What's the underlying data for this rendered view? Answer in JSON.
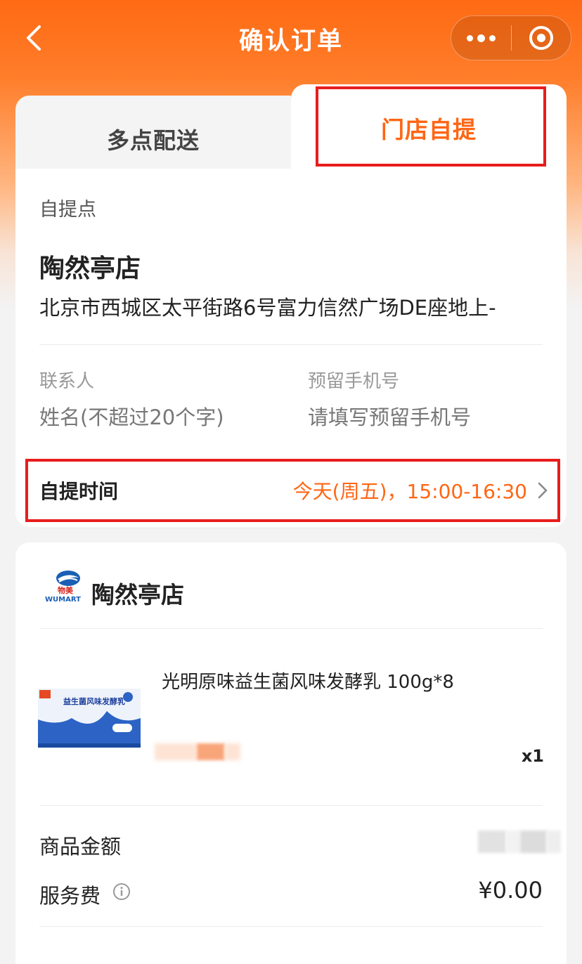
{
  "header": {
    "title": "确认订单",
    "back_icon": "chevron-left-icon",
    "more_icon": "more-dots-icon",
    "close_icon": "mini-program-close-icon"
  },
  "tabs": [
    {
      "label": "多点配送",
      "active": false
    },
    {
      "label": "门店自提",
      "active": true
    }
  ],
  "pickup": {
    "section_label": "自提点",
    "store_name": "陶然亭店",
    "address": "北京市西城区太平街路6号富力信然广场DE座地上-",
    "contact": {
      "label": "联系人",
      "placeholder": "姓名(不超过20个字)"
    },
    "phone": {
      "label": "预留手机号",
      "placeholder": "请填写预留手机号"
    },
    "time": {
      "label": "自提时间",
      "value": "今天(周五)，15:00-16:30"
    }
  },
  "order": {
    "brand_logo": "wumart-logo",
    "brand_logo_text": [
      "物美",
      "WUMART"
    ],
    "store_name": "陶然亭店",
    "product": {
      "name": "光明原味益生菌风味发酵乳 100g*8",
      "image": "probiotic-yogurt-box",
      "image_text": "益生菌风味发酵乳",
      "quantity": "x1"
    },
    "goods_amount_label": "商品金额",
    "service_fee_label": "服务费",
    "service_fee_value": "¥0.00"
  },
  "colors": {
    "brand_orange": "#ff6614",
    "header_orange": "#ff6a13",
    "highlight_red": "#e81d1d"
  }
}
